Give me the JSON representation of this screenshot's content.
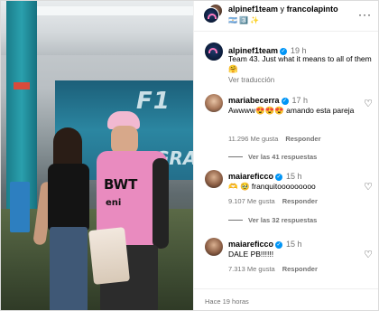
{
  "header": {
    "account1": "alpinef1team",
    "connector": "y",
    "account2": "francolapinto",
    "subtitle": "🇦🇷 3️⃣ ✨"
  },
  "caption": {
    "username": "alpinef1team",
    "time": "19 h",
    "text": "Team 43. Just what it means to all of them 🤗",
    "translate": "Ver traducción"
  },
  "comments": [
    {
      "username": "mariabecerra",
      "time": "17 h",
      "text": "Awwww😍😍😍 amando esta pareja",
      "likes": "11.296 Me gusta",
      "reply": "Responder",
      "replies": "Ver las 41 respuestas"
    },
    {
      "username": "maiareficco",
      "time": "15 h",
      "text": "🫶 🥹 franquitooooooooo",
      "likes": "9.107 Me gusta",
      "reply": "Responder",
      "replies": "Ver las 32 respuestas"
    },
    {
      "username": "maiareficco",
      "time": "15 h",
      "text": "DALE PB!!!!!!",
      "likes": "7.313 Me gusta",
      "reply": "Responder",
      "replies": ""
    }
  ],
  "footer": {
    "time": "Hace 19 horas"
  },
  "photo": {
    "banner_text_1": "F1",
    "banner_text_2": "GRA",
    "suit_logo": "BWT",
    "suit_sponsor": "eni"
  },
  "colors": {
    "verified": "#0095f6",
    "secondary_text": "#737373",
    "border": "#dbdbdb"
  },
  "icons": {
    "more": "more-options-icon",
    "heart": "heart-outline-icon",
    "verified": "verified-badge-icon"
  }
}
